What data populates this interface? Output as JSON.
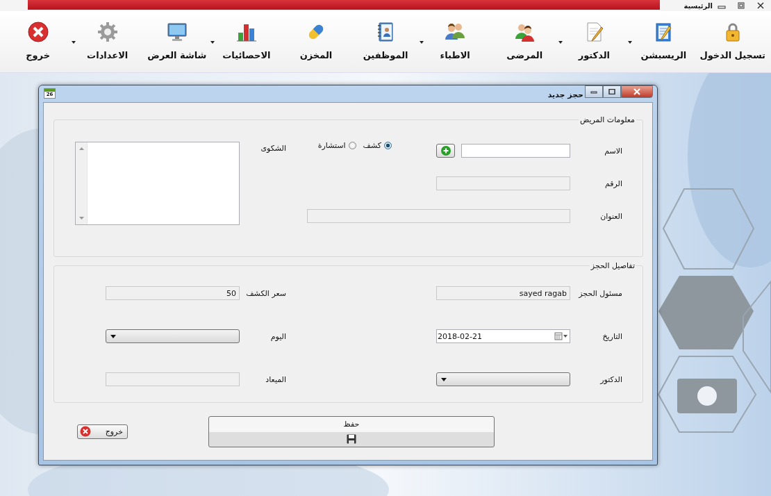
{
  "main_window": {
    "title": "الرئيسية"
  },
  "toolbar": [
    {
      "label": "تسجيل الدخول",
      "has_menu": false
    },
    {
      "label": "الريسبشن",
      "has_menu": true
    },
    {
      "label": "الدكتور",
      "has_menu": true
    },
    {
      "label": "المرضى",
      "has_menu": false
    },
    {
      "label": "الاطباء",
      "has_menu": true
    },
    {
      "label": "الموظفين",
      "has_menu": false
    },
    {
      "label": "المخزن",
      "has_menu": false
    },
    {
      "label": "الاحصائيات",
      "has_menu": true
    },
    {
      "label": "شاشة العرض",
      "has_menu": false
    },
    {
      "label": "الاعدادات",
      "has_menu": true
    },
    {
      "label": "خروج",
      "has_menu": false
    }
  ],
  "dialog": {
    "title": "حجز جديد",
    "icon_text": "26",
    "patient_info": {
      "title": "معلومات المريض",
      "name": {
        "label": "الاسم",
        "disabled": false
      },
      "number": {
        "label": "الرقم",
        "disabled": true
      },
      "address": {
        "label": "العنوان",
        "disabled": true
      },
      "visit_type": [
        {
          "label": "كشف",
          "selected": true
        },
        {
          "label": "استشارة",
          "selected": false
        }
      ],
      "complaint": {
        "label": "الشكوى"
      }
    },
    "booking_details": {
      "title": "تفاصيل الحجز",
      "fields": [
        {
          "kind": "text",
          "label": "مسئول الحجز",
          "value": "sayed ragab",
          "disabled": true
        },
        {
          "kind": "text",
          "label": "سعر الكشف",
          "value": "50",
          "disabled": true
        },
        {
          "kind": "date",
          "label": "التاريخ",
          "value": "2018-02-21"
        },
        {
          "kind": "combo",
          "label": "اليوم"
        },
        {
          "kind": "combo",
          "label": "الدكتور"
        },
        {
          "kind": "text",
          "label": "الميعاد",
          "disabled": true
        }
      ]
    },
    "buttons": {
      "exit": "خروج",
      "save": "حفظ"
    }
  }
}
